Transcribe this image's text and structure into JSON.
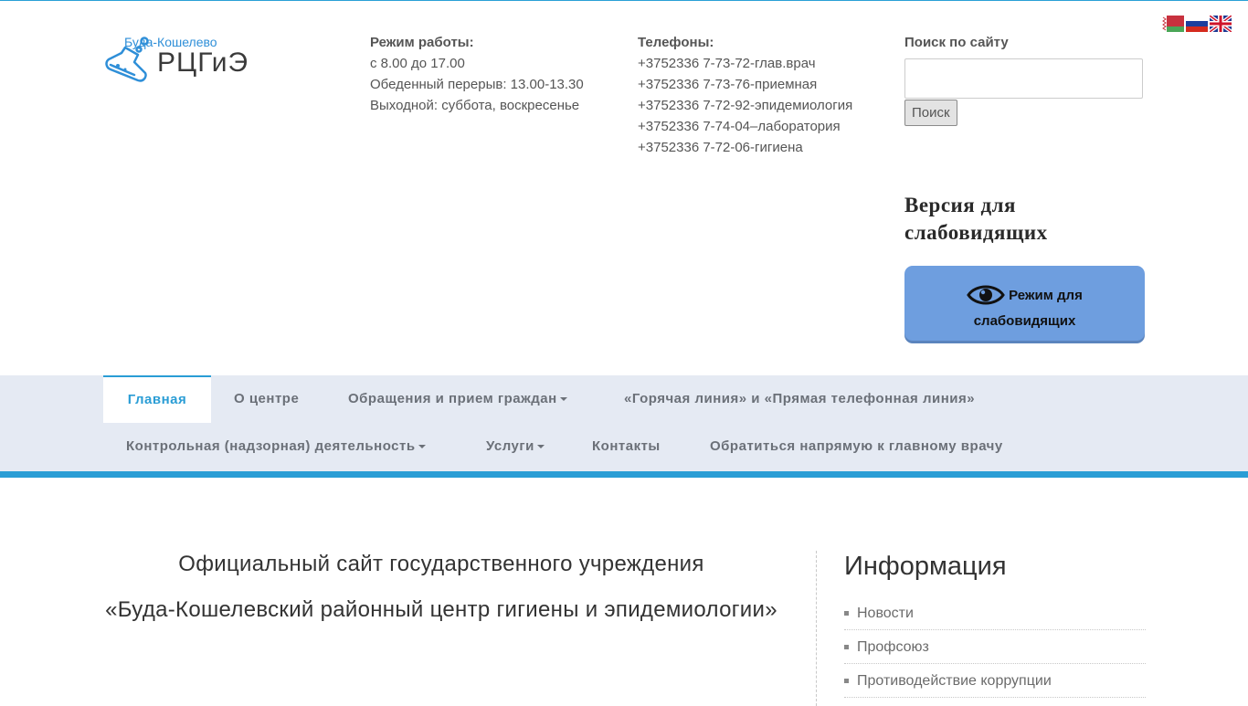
{
  "header": {
    "logo": {
      "town": "Буда-Кошелево",
      "abbr": "РЦГиЭ"
    },
    "hours": {
      "title": "Режим работы:",
      "lines": [
        "с 8.00 до 17.00",
        "Обеденный перерыв: 13.00-13.30",
        "Выходной: суббота, воскресенье"
      ]
    },
    "phones": {
      "title": "Телефоны:",
      "lines": [
        "+3752336 7-73-72-глав.врач",
        "+3752336 7-73-76-приемная",
        "+3752336 7-72-92-эпидемиология",
        "+3752336 7-74-04–лаборатория",
        "+3752336 7-72-06-гигиена"
      ]
    },
    "search": {
      "title": "Поиск по сайту",
      "value": "",
      "button": "Поиск"
    },
    "vision": {
      "title": "Версия для слабовидящих",
      "button_line1": "Режим для",
      "button_line2": "слабовидящих"
    },
    "languages": [
      "be",
      "ru",
      "en"
    ]
  },
  "nav": {
    "items": [
      {
        "label": "Главная",
        "active": true
      },
      {
        "label": "О центре"
      },
      {
        "label": "Обращения и прием граждан",
        "dropdown": true
      },
      {
        "label": "«Горячая линия» и «Прямая телефонная линия»"
      },
      {
        "label": "Контрольная (надзорная) деятельность",
        "dropdown": true
      },
      {
        "label": "Услуги",
        "dropdown": true
      },
      {
        "label": "Контакты"
      },
      {
        "label": "Обратиться напрямую к главному врачу"
      }
    ]
  },
  "main": {
    "title_line1": "Официальный сайт государственного учреждения",
    "title_line2": "«Буда-Кошелевский районный центр гигиены и эпидемиологии»"
  },
  "sidebar": {
    "title": "Информация",
    "items": [
      "Новости",
      "Профсоюз",
      "Противодействие коррупции"
    ]
  },
  "colors": {
    "accent": "#2a9dd5",
    "nav_bg": "#e5eaf3",
    "vision_button": "#6e9edf"
  }
}
